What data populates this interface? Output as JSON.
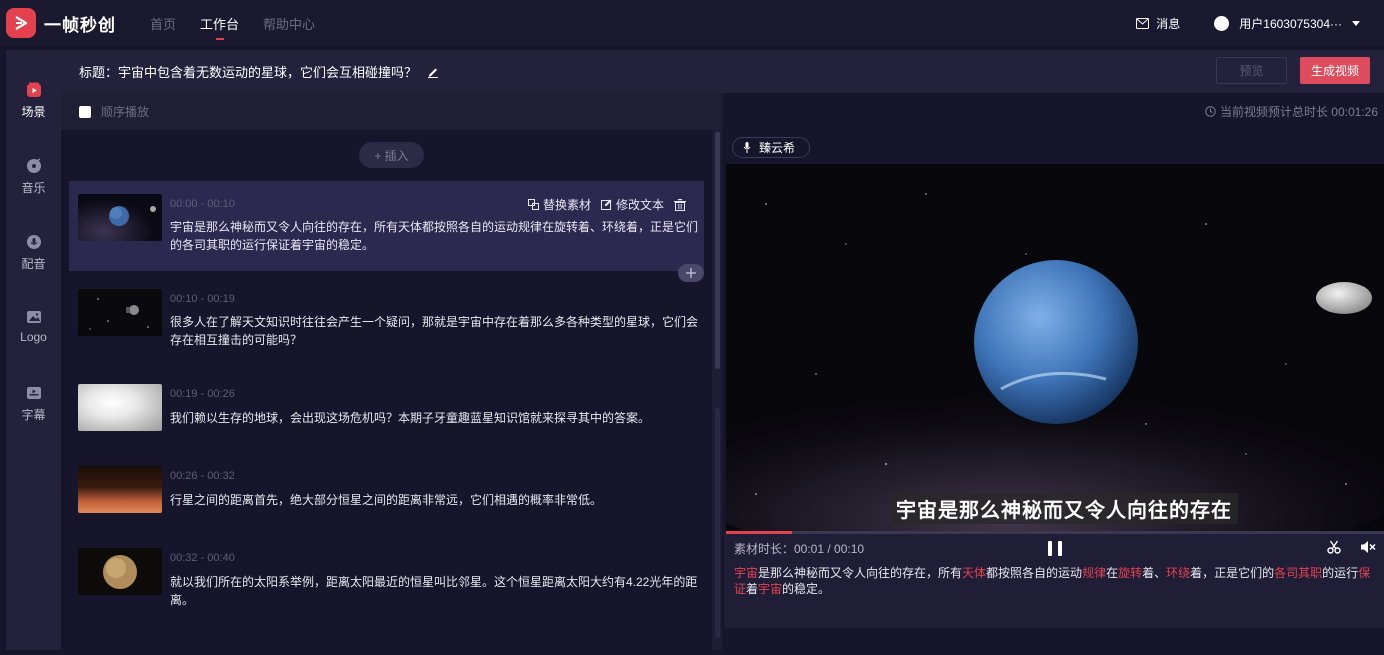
{
  "brand": {
    "name": "一帧秒创",
    "accent": "#e4414f"
  },
  "nav": [
    {
      "label": "首页",
      "active": false
    },
    {
      "label": "工作台",
      "active": true
    },
    {
      "label": "帮助中心",
      "active": false
    }
  ],
  "header": {
    "messages_label": "消息",
    "username": "用户1603075304···"
  },
  "sidebar": {
    "items": [
      {
        "label": "场景",
        "icon": "scene-icon",
        "active": true
      },
      {
        "label": "音乐",
        "icon": "music-icon",
        "active": false
      },
      {
        "label": "配音",
        "icon": "voiceover-icon",
        "active": false
      },
      {
        "label": "Logo",
        "icon": "logo-icon",
        "active": false
      },
      {
        "label": "字幕",
        "icon": "subtitle-icon",
        "active": false
      }
    ]
  },
  "titlebar": {
    "title": "标题：宇宙中包含着无数运动的星球，它们会互相碰撞吗？",
    "preview_label": "预览",
    "generate_label": "生成视频"
  },
  "scene_list": {
    "sequential_play_label": "顺序播放",
    "insert_label": "+ 插入",
    "actions": {
      "replace": "替换素材",
      "edit": "修改文本"
    },
    "scenes": [
      {
        "time": "00:00 - 00:10",
        "text": "宇宙是那么神秘而又令人向往的存在，所有天体都按照各自的运动规律在旋转着、环绕着，正是它们的各司其职的运行保证着宇宙的稳定。",
        "thumb": "planet-blue"
      },
      {
        "time": "00:10 - 00:19",
        "text": "很多人在了解天文知识时往往会产生一个疑问，那就是宇宙中存在着那么多各种类型的星球，它们会存在相互撞击的可能吗？",
        "thumb": "satellite"
      },
      {
        "time": "00:19 - 00:26",
        "text": "我们赖以生存的地球，会出现这场危机吗？本期子牙童趣蓝星知识馆就来探寻其中的答案。",
        "thumb": "bright-light"
      },
      {
        "time": "00:26 - 00:32",
        "text": "行星之间的距离首先，绝大部分恒星之间的距离非常远，它们相遇的概率非常低。",
        "thumb": "planet-surface"
      },
      {
        "time": "00:32 - 00:40",
        "text": "就以我们所在的太阳系举例，距离太阳最近的恒星叫比邻星。这个恒星距离太阳大约有4.22光年的距离。",
        "thumb": "venus"
      }
    ]
  },
  "preview": {
    "total_duration_label": "当前视频预计总时长 00:01:26",
    "voice_name": "臻云希",
    "video_subtitle": "宇宙是那么神秘而又令人向往的存在",
    "material_duration": "素材时长：00:01 / 00:10",
    "progress_fraction": 0.1,
    "subtitle_segments": [
      {
        "t": "宇宙",
        "h": true
      },
      {
        "t": "是那么神秘而又令人向往的存在，所有",
        "h": false
      },
      {
        "t": "天体",
        "h": true
      },
      {
        "t": "都按照各自的运动",
        "h": false
      },
      {
        "t": "规律",
        "h": true
      },
      {
        "t": "在",
        "h": false
      },
      {
        "t": "旋转",
        "h": true
      },
      {
        "t": "着、",
        "h": false
      },
      {
        "t": "环绕",
        "h": true
      },
      {
        "t": "着，正是它们的",
        "h": false
      },
      {
        "t": "各司其职",
        "h": true
      },
      {
        "t": "的运行",
        "h": false
      },
      {
        "t": "保证",
        "h": true
      },
      {
        "t": "着",
        "h": false
      },
      {
        "t": "宇宙",
        "h": true
      },
      {
        "t": "的稳定。",
        "h": false
      }
    ]
  }
}
